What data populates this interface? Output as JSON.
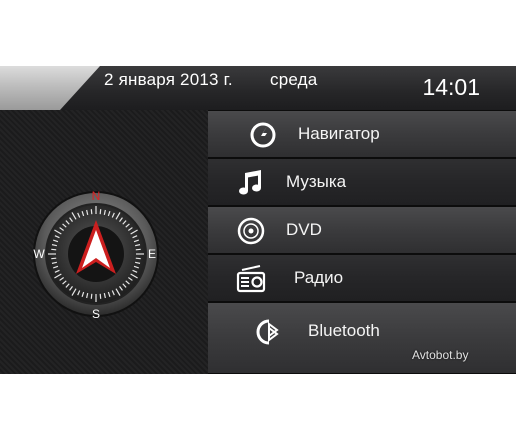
{
  "status_bar": {
    "date": "2 января 2013 г.",
    "weekday": "среда",
    "time": "14:01"
  },
  "compass": {
    "north": "N",
    "south": "S",
    "east": "E",
    "west": "W"
  },
  "menu": {
    "items": [
      {
        "label": "Навигатор",
        "icon": "navigator-icon"
      },
      {
        "label": "Музыка",
        "icon": "music-note-icon"
      },
      {
        "label": "DVD",
        "icon": "disc-icon"
      },
      {
        "label": "Радио",
        "icon": "radio-icon"
      },
      {
        "label": "Bluetooth",
        "icon": "bluetooth-icon"
      }
    ]
  },
  "watermark": "Avtobot.by",
  "colors": {
    "accent_red": "#cc1f1f",
    "background": "#1e1e1f",
    "text": "#ffffff"
  }
}
